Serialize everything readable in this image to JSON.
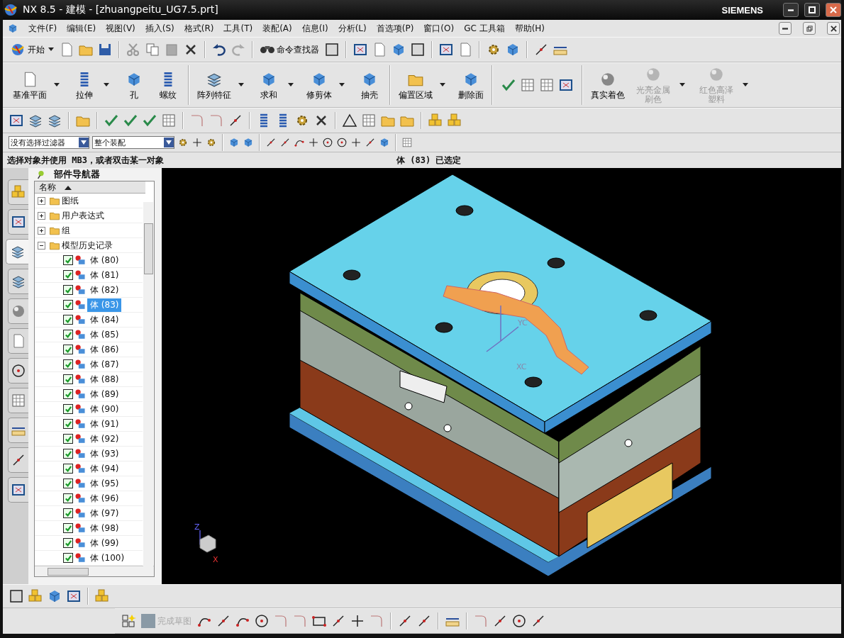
{
  "window": {
    "title": "NX 8.5 - 建模 - [zhuangpeitu_UG7.5.prt]",
    "brand": "SIEMENS"
  },
  "menu": [
    "文件(F)",
    "编辑(E)",
    "视图(V)",
    "插入(S)",
    "格式(R)",
    "工具(T)",
    "装配(A)",
    "信息(I)",
    "分析(L)",
    "首选项(P)",
    "窗口(O)",
    "GC 工具箱",
    "帮助(H)"
  ],
  "standard_toolbar": {
    "start": "开始",
    "command_finder": "命令查找器"
  },
  "feature_toolbar": [
    {
      "label": "基准平面",
      "disabled": false,
      "dropdown": true
    },
    {
      "label": "拉伸",
      "disabled": false,
      "dropdown": true
    },
    {
      "label": "孔",
      "disabled": false,
      "dropdown": false
    },
    {
      "label": "螺纹",
      "disabled": false,
      "dropdown": false
    },
    {
      "label": "阵列特征",
      "disabled": false,
      "dropdown": true
    },
    {
      "label": "求和",
      "disabled": false,
      "dropdown": true
    },
    {
      "label": "修剪体",
      "disabled": false,
      "dropdown": true
    },
    {
      "label": "抽壳",
      "disabled": false,
      "dropdown": false
    },
    {
      "label": "偏置区域",
      "disabled": false,
      "dropdown": true
    },
    {
      "label": "删除面",
      "disabled": false,
      "dropdown": false
    },
    {
      "label": "真实着色",
      "disabled": false,
      "dropdown": false
    },
    {
      "label": "光亮金属刷色",
      "disabled": true,
      "dropdown": true
    },
    {
      "label": "红色高泽塑料",
      "disabled": true,
      "dropdown": true
    }
  ],
  "selection_bar": {
    "filter": "没有选择过滤器",
    "scope": "整个装配"
  },
  "status_bar": {
    "prompt": "选择对象并使用 MB3，或者双击某一对象",
    "message": "体 (83) 已选定"
  },
  "resource_tabs": [
    {
      "selected": false
    },
    {
      "selected": false
    },
    {
      "selected": true
    },
    {
      "selected": false
    },
    {
      "selected": false
    },
    {
      "selected": false
    },
    {
      "selected": false
    },
    {
      "selected": false
    },
    {
      "selected": false
    },
    {
      "selected": false
    },
    {
      "selected": false
    }
  ],
  "navigator": {
    "title": "部件导航器",
    "column": "名称",
    "tree": [
      {
        "label": "图纸",
        "expanded": false
      },
      {
        "label": "用户表达式",
        "expanded": false
      },
      {
        "label": "组",
        "expanded": false
      },
      {
        "label": "模型历史记录",
        "expanded": true,
        "children": [
          {
            "label": "体 (80)",
            "checked": true,
            "selected": false
          },
          {
            "label": "体 (81)",
            "checked": true,
            "selected": false
          },
          {
            "label": "体 (82)",
            "checked": true,
            "selected": false
          },
          {
            "label": "体 (83)",
            "checked": true,
            "selected": true
          },
          {
            "label": "体 (84)",
            "checked": true,
            "selected": false
          },
          {
            "label": "体 (85)",
            "checked": true,
            "selected": false
          },
          {
            "label": "体 (86)",
            "checked": true,
            "selected": false
          },
          {
            "label": "体 (87)",
            "checked": true,
            "selected": false
          },
          {
            "label": "体 (88)",
            "checked": true,
            "selected": false
          },
          {
            "label": "体 (89)",
            "checked": true,
            "selected": false
          },
          {
            "label": "体 (90)",
            "checked": true,
            "selected": false
          },
          {
            "label": "体 (91)",
            "checked": true,
            "selected": false
          },
          {
            "label": "体 (92)",
            "checked": true,
            "selected": false
          },
          {
            "label": "体 (93)",
            "checked": true,
            "selected": false
          },
          {
            "label": "体 (94)",
            "checked": true,
            "selected": false
          },
          {
            "label": "体 (95)",
            "checked": true,
            "selected": false
          },
          {
            "label": "体 (96)",
            "checked": true,
            "selected": false
          },
          {
            "label": "体 (97)",
            "checked": true,
            "selected": false
          },
          {
            "label": "体 (98)",
            "checked": true,
            "selected": false
          },
          {
            "label": "体 (99)",
            "checked": true,
            "selected": false
          },
          {
            "label": "体 (100)",
            "checked": true,
            "selected": false
          }
        ]
      }
    ]
  },
  "viewport": {
    "wcs_y": "YC",
    "wcs_x": "XC",
    "triad_z": "Z",
    "triad_x": "X"
  },
  "sketch_toolbar": {
    "finish": "完成草图"
  }
}
